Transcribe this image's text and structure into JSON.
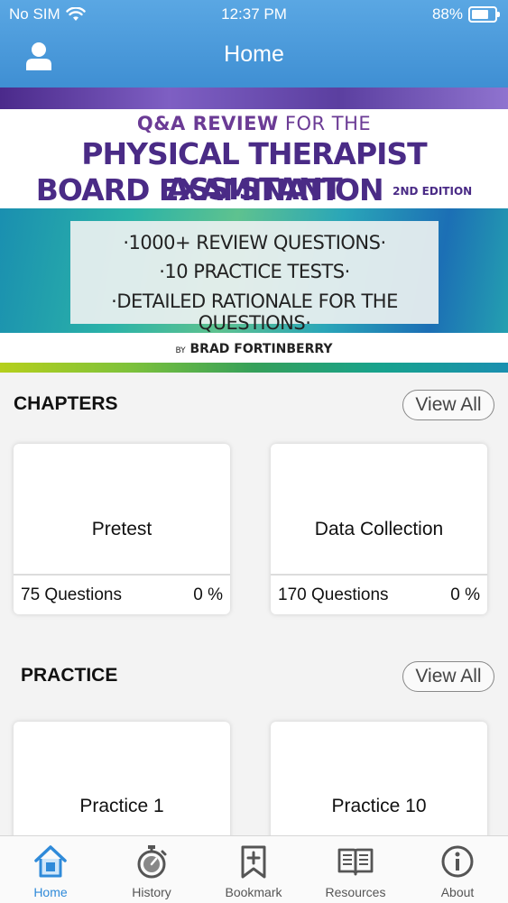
{
  "status_bar": {
    "carrier": "No SIM",
    "time": "12:37 PM",
    "battery": "88%",
    "battery_level": 0.88
  },
  "nav": {
    "title": "Home",
    "profile_icon": "user-icon"
  },
  "banner": {
    "line1_bold": "Q&A REVIEW",
    "line1_light": " FOR THE",
    "line2": "PHYSICAL THERAPIST ASSISTANT",
    "line3": "BOARD EXAMINATION",
    "edition": "2ND EDITION",
    "bullets": [
      "·1000+ REVIEW QUESTIONS·",
      "·10 PRACTICE TESTS·",
      "·DETAILED RATIONALE FOR THE QUESTIONS·"
    ],
    "author_prefix": "BY",
    "author": "BRAD FORTINBERRY"
  },
  "chapters": {
    "heading": "CHAPTERS",
    "view_all": "View All",
    "cards": [
      {
        "name": "Pretest",
        "questions": "75 Questions",
        "percent": "0 %"
      },
      {
        "name": "Data Collection",
        "questions": "170 Questions",
        "percent": "0 %"
      }
    ]
  },
  "practice": {
    "heading": "PRACTICE",
    "view_all": "View All",
    "cards": [
      {
        "name": "Practice 1"
      },
      {
        "name": "Practice 10"
      }
    ]
  },
  "tabs": [
    {
      "label": "Home",
      "icon": "home-icon",
      "active": true
    },
    {
      "label": "History",
      "icon": "stopwatch-icon",
      "active": false
    },
    {
      "label": "Bookmark",
      "icon": "bookmark-icon",
      "active": false
    },
    {
      "label": "Resources",
      "icon": "book-icon",
      "active": false
    },
    {
      "label": "About",
      "icon": "info-icon",
      "active": false
    }
  ],
  "colors": {
    "nav_bar": "#4a9ad9",
    "active_tab": "#2f8ad9",
    "banner_purple": "#4a2b86"
  }
}
